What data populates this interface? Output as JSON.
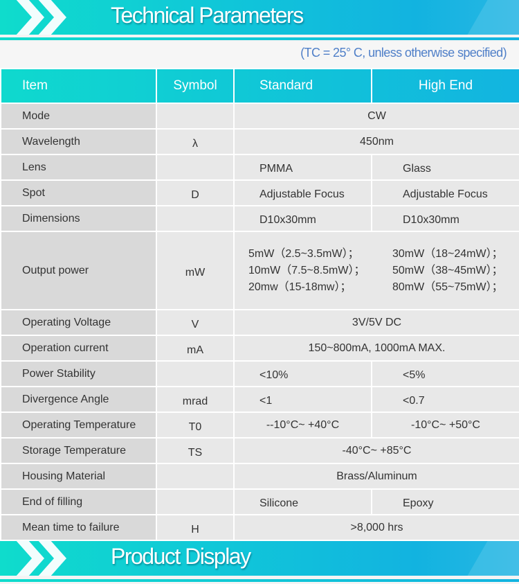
{
  "header": {
    "title": "Technical Parameters",
    "note": "(TC = 25° C, unless otherwise specified)"
  },
  "table": {
    "columns": [
      "Item",
      "Symbol",
      "Standard",
      "High End"
    ],
    "rows": [
      {
        "item": "Mode",
        "symbol": "",
        "value": "CW"
      },
      {
        "item": "Wavelength",
        "symbol": "λ",
        "value": "450nm"
      },
      {
        "item": "Lens",
        "symbol": "",
        "standard": "PMMA",
        "high_end": "Glass"
      },
      {
        "item": "Spot",
        "symbol": "D",
        "standard": "Adjustable Focus",
        "high_end": "Adjustable Focus"
      },
      {
        "item": "Dimensions",
        "symbol": "",
        "standard": "D10x30mm",
        "high_end": "D10x30mm"
      },
      {
        "item": "Output power",
        "symbol": "mW",
        "standard_lines": [
          "5mW（2.5~3.5mW）；",
          "10mW（7.5~8.5mW）；",
          "20mw（15-18mw）；"
        ],
        "high_end_lines": [
          "30mW（18~24mW）；",
          "50mW（38~45mW）；",
          "80mW（55~75mW）；"
        ]
      },
      {
        "item": "Operating Voltage",
        "symbol": "V",
        "value": "3V/5V DC"
      },
      {
        "item": "Operation current",
        "symbol": "mA",
        "value": "150~800mA, 1000mA MAX."
      },
      {
        "item": "Power Stability",
        "symbol": "",
        "standard": "<10%",
        "high_end": "<5%"
      },
      {
        "item": "Divergence Angle",
        "symbol": "mrad",
        "standard": "<1",
        "high_end": "<0.7"
      },
      {
        "item": "Operating Temperature",
        "symbol": "T0",
        "standard": "--10°C~ +40°C",
        "high_end": "-10°C~ +50°C"
      },
      {
        "item": "Storage Temperature",
        "symbol": "TS",
        "value": "-40°C~ +85°C"
      },
      {
        "item": "Housing Material",
        "symbol": "",
        "value": "Brass/Aluminum"
      },
      {
        "item": "End of filling",
        "symbol": "",
        "standard": "Silicone",
        "high_end": "Epoxy"
      },
      {
        "item": "Mean time to failure",
        "symbol": "H",
        "value": ">8,000 hrs"
      }
    ]
  },
  "footer": {
    "title": "Product Display"
  },
  "colors": {
    "banner_start": "#0fdccc",
    "banner_end": "#12b3e0",
    "note_text": "#4f7fc8",
    "item_cell": "#d9d9d9",
    "value_cell": "#e8e8e8"
  },
  "icons": {
    "banner_chevrons": "double-chevron-right-icon"
  }
}
